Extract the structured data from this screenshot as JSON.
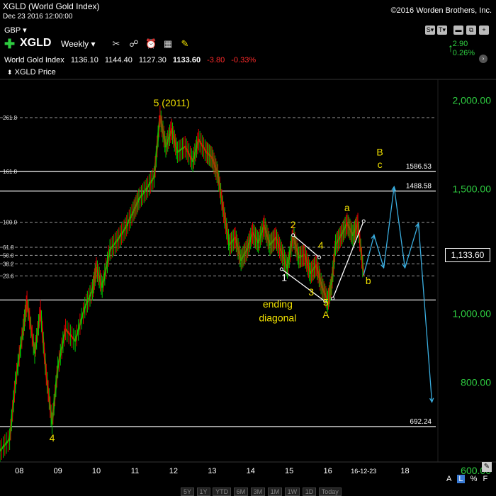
{
  "header": {
    "title": "XGLD (World Gold Index)",
    "date": "Dec 23 2016 12:00:00",
    "copyright": "©2016 Worden Brothers, Inc.",
    "currency": "GBP ▾",
    "symbol": "XGLD",
    "period": "Weekly ▾",
    "change_value": "2.90",
    "change_pct": "0.26%"
  },
  "ohlc": {
    "name": "World Gold Index",
    "open": "1136.10",
    "high": "1144.40",
    "low": "1127.30",
    "last": "1133.60",
    "change": "-3.80",
    "change_pct": "-0.33%"
  },
  "legend": {
    "price_label": "XGLD Price"
  },
  "last_price_box": "1,133.60",
  "right_buttons": [
    "S▾",
    "T▾",
    "▬",
    "⧉",
    "+"
  ],
  "scale_buttons": {
    "a": "A",
    "l": "L",
    "p": "%",
    "f": "F"
  },
  "range_buttons": [
    "5Y",
    "1Y",
    "YTD",
    "6M",
    "3M",
    "1M",
    "1W",
    "1D",
    "Today"
  ],
  "colors": {
    "up": "#00c800",
    "down": "#e00000",
    "annot": "#f0e000",
    "forecast": "#3aaee0",
    "hline": "#ffffff"
  },
  "chart_data": {
    "type": "line",
    "scale": "log",
    "ylim": [
      620,
      2150
    ],
    "xlim": [
      2007.5,
      2018.8
    ],
    "y_ticks": [
      {
        "value": 2000,
        "label": "2,000.00"
      },
      {
        "value": 1500,
        "label": "1,500.00"
      },
      {
        "value": 1000,
        "label": "1,000.00"
      },
      {
        "value": 800,
        "label": "800.00"
      },
      {
        "value": 600,
        "label": "600.00"
      }
    ],
    "x_ticks": [
      {
        "x": 2008,
        "label": "08"
      },
      {
        "x": 2009,
        "label": "09"
      },
      {
        "x": 2010,
        "label": "10"
      },
      {
        "x": 2011,
        "label": "11"
      },
      {
        "x": 2012,
        "label": "12"
      },
      {
        "x": 2013,
        "label": "13"
      },
      {
        "x": 2014,
        "label": "14"
      },
      {
        "x": 2015,
        "label": "15"
      },
      {
        "x": 2016,
        "label": "16"
      },
      {
        "x": 2016.93,
        "label": "16-12-23"
      },
      {
        "x": 2018,
        "label": "18"
      }
    ],
    "price_path": [
      [
        2007.5,
        640
      ],
      [
        2007.75,
        665
      ],
      [
        2007.9,
        800
      ],
      [
        2008.1,
        950
      ],
      [
        2008.2,
        1040
      ],
      [
        2008.4,
        880
      ],
      [
        2008.55,
        1010
      ],
      [
        2008.7,
        820
      ],
      [
        2008.85,
        700
      ],
      [
        2009.0,
        840
      ],
      [
        2009.2,
        950
      ],
      [
        2009.45,
        915
      ],
      [
        2009.7,
        1020
      ],
      [
        2009.9,
        1080
      ],
      [
        2010.0,
        1160
      ],
      [
        2010.15,
        1090
      ],
      [
        2010.35,
        1230
      ],
      [
        2010.55,
        1270
      ],
      [
        2010.75,
        1320
      ],
      [
        2010.95,
        1390
      ],
      [
        2011.1,
        1450
      ],
      [
        2011.3,
        1500
      ],
      [
        2011.5,
        1560
      ],
      [
        2011.65,
        1900
      ],
      [
        2011.8,
        1720
      ],
      [
        2011.95,
        1820
      ],
      [
        2012.1,
        1690
      ],
      [
        2012.3,
        1720
      ],
      [
        2012.5,
        1640
      ],
      [
        2012.65,
        1760
      ],
      [
        2012.85,
        1690
      ],
      [
        2013.0,
        1660
      ],
      [
        2013.15,
        1570
      ],
      [
        2013.3,
        1390
      ],
      [
        2013.45,
        1250
      ],
      [
        2013.6,
        1280
      ],
      [
        2013.75,
        1190
      ],
      [
        2013.9,
        1230
      ],
      [
        2014.05,
        1300
      ],
      [
        2014.2,
        1260
      ],
      [
        2014.35,
        1330
      ],
      [
        2014.5,
        1250
      ],
      [
        2014.65,
        1280
      ],
      [
        2014.8,
        1220
      ],
      [
        2014.95,
        1160
      ],
      [
        2015.1,
        1290
      ],
      [
        2015.25,
        1200
      ],
      [
        2015.4,
        1210
      ],
      [
        2015.55,
        1140
      ],
      [
        2015.7,
        1170
      ],
      [
        2015.85,
        1090
      ],
      [
        2016.0,
        1040
      ],
      [
        2016.1,
        1100
      ],
      [
        2016.2,
        1250
      ],
      [
        2016.35,
        1290
      ],
      [
        2016.5,
        1340
      ],
      [
        2016.65,
        1290
      ],
      [
        2016.78,
        1340
      ],
      [
        2016.93,
        1133.6
      ]
    ],
    "h_lines": [
      {
        "value": 1586.53,
        "label": "1586.53",
        "style": "solid"
      },
      {
        "value": 1488.58,
        "label": "1488.58",
        "style": "solid"
      },
      {
        "value": 692.24,
        "label": "692.24",
        "style": "solid"
      },
      {
        "value": 1045,
        "label": "",
        "style": "solid"
      }
    ],
    "fib_lines": [
      {
        "value": 1890,
        "label": "261.8"
      },
      {
        "value": 1586.53,
        "label": "161.8"
      },
      {
        "value": 1345,
        "label": "100.0"
      },
      {
        "value": 1240,
        "label": "61.8"
      },
      {
        "value": 1208,
        "label": "50.0"
      },
      {
        "value": 1175,
        "label": "38.2"
      },
      {
        "value": 1130,
        "label": "23.6"
      }
    ],
    "wave_labels": [
      {
        "text": "5 (2011)",
        "x": 2011.95,
        "y": 1960,
        "color": "#f0e000"
      },
      {
        "text": "4",
        "x": 2008.85,
        "y": 660,
        "color": "#f0e000"
      },
      {
        "text": "1",
        "x": 2014.87,
        "y": 1112,
        "color": "#ffffff"
      },
      {
        "text": "2",
        "x": 2015.1,
        "y": 1320,
        "color": "#f0e000"
      },
      {
        "text": "3",
        "x": 2015.57,
        "y": 1060,
        "color": "#f0e000"
      },
      {
        "text": "4",
        "x": 2015.82,
        "y": 1235,
        "color": "#f0e000"
      },
      {
        "text": "5",
        "x": 2015.95,
        "y": 1025,
        "color": "#f0e000"
      },
      {
        "text": "A",
        "x": 2015.95,
        "y": 985,
        "color": "#f0e000"
      },
      {
        "text": "a",
        "x": 2016.5,
        "y": 1395,
        "color": "#f0e000"
      },
      {
        "text": "b",
        "x": 2017.05,
        "y": 1100,
        "color": "#f0e000"
      },
      {
        "text": "B",
        "x": 2017.35,
        "y": 1670,
        "color": "#f0e000"
      },
      {
        "text": "c",
        "x": 2017.35,
        "y": 1605,
        "color": "#f0e000"
      },
      {
        "text": "ending",
        "x": 2014.7,
        "y": 1020,
        "color": "#f0e000"
      },
      {
        "text": "diagonal",
        "x": 2014.7,
        "y": 975,
        "color": "#f0e000"
      }
    ],
    "diagonal_lines": [
      [
        [
          2014.8,
          1155
        ],
        [
          2015.93,
          1040
        ]
      ],
      [
        [
          2015.1,
          1290
        ],
        [
          2015.78,
          1200
        ]
      ],
      [
        [
          2016.13,
          1050
        ],
        [
          2016.93,
          1350
        ]
      ]
    ],
    "forecast_path": [
      [
        2016.93,
        1133.6
      ],
      [
        2017.2,
        1290
      ],
      [
        2017.45,
        1160
      ],
      [
        2017.72,
        1510
      ],
      [
        2018.0,
        1160
      ],
      [
        2018.35,
        1340
      ],
      [
        2018.7,
        750
      ]
    ]
  }
}
